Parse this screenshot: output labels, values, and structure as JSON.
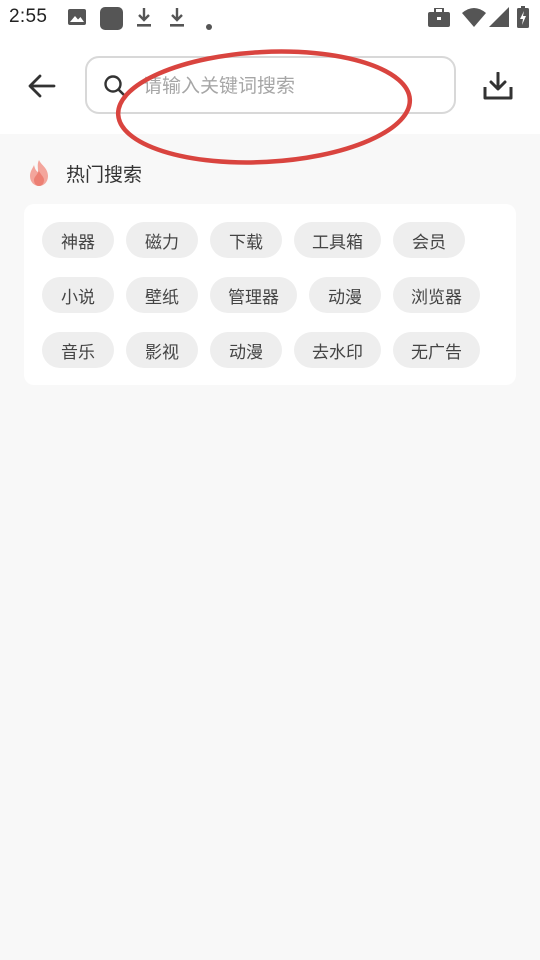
{
  "status_bar": {
    "time": "2:55",
    "left_icons": [
      "image-icon",
      "app-square-icon",
      "download-arrow-icon",
      "download-arrow-icon",
      "dot-icon"
    ],
    "right_icons": [
      "briefcase-icon",
      "wifi-icon",
      "signal-icon",
      "battery-charging-icon"
    ]
  },
  "header": {
    "back_icon": "arrow-left-icon",
    "search_placeholder": "请输入关键词搜索",
    "search_value": "",
    "download_icon": "download-tray-icon"
  },
  "annotation": {
    "shape": "ellipse",
    "color": "#d9443f"
  },
  "hot_search": {
    "icon": "flame-icon",
    "title": "热门搜索",
    "tags": [
      "神器",
      "磁力",
      "下载",
      "工具箱",
      "会员",
      "小说",
      "壁纸",
      "管理器",
      "动漫",
      "浏览器",
      "音乐",
      "影视",
      "动漫",
      "去水印",
      "无广告"
    ]
  },
  "colors": {
    "page_bg": "#f8f8f8",
    "card_bg": "#ffffff",
    "tag_bg": "#eeeeee",
    "flame": "#f08c82"
  }
}
